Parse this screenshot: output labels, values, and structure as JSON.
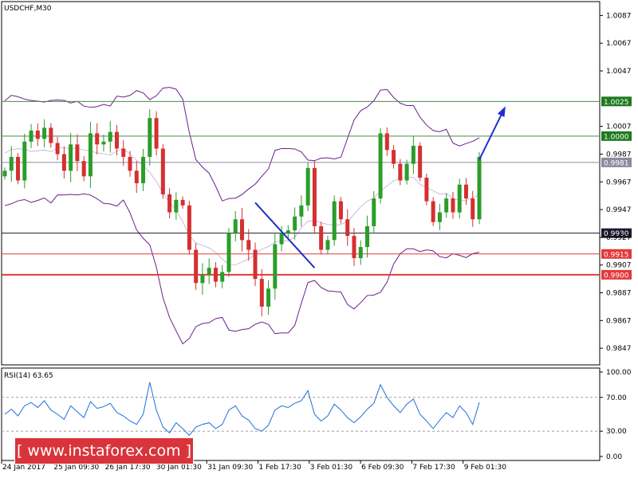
{
  "chart_data": [
    {
      "type": "candlestick",
      "title": "USDCHF,M30",
      "ylim": [
        0.9835,
        1.0097
      ],
      "y_ticks": [
        "1.0087",
        "1.0067",
        "1.0047",
        "1.0007",
        "0.9987",
        "0.9967",
        "0.9947",
        "0.9927",
        "0.9907",
        "0.9887",
        "0.9867",
        "0.9847"
      ],
      "x_ticks": [
        "24 Jan 2017",
        "25 Jan 09:30",
        "26 Jan 17:30",
        "30 Jan 01:30",
        "31 Jan 09:30",
        "1 Feb 17:30",
        "3 Feb 01:30",
        "6 Feb 09:30",
        "7 Feb 17:30",
        "9 Feb 01:30"
      ],
      "price_series": {
        "name": "",
        "points": [
          0.9975,
          0.9985,
          0.9968,
          0.9996,
          1.0004,
          0.9998,
          1.0006,
          0.9995,
          0.9987,
          0.9975,
          0.9994,
          0.9982,
          0.9971,
          1.0002,
          0.9994,
          0.9996,
          1.0003,
          0.9991,
          0.9985,
          0.9975,
          0.9966,
          0.9985,
          1.0013,
          0.9991,
          0.9958,
          0.9945,
          0.9954,
          0.995,
          0.9918,
          0.9894,
          0.99,
          0.9905,
          0.9895,
          0.9902,
          0.993,
          0.994,
          0.9925,
          0.9918,
          0.9897,
          0.9877,
          0.989,
          0.9922,
          0.993,
          0.9932,
          0.9942,
          0.995,
          0.9977,
          0.9935,
          0.9918,
          0.9925,
          0.9953,
          0.994,
          0.9928,
          0.9912,
          0.992,
          0.9935,
          0.9955,
          1.0002,
          0.999,
          0.998,
          0.9968,
          0.998,
          0.9993,
          0.997,
          0.9953,
          0.9938,
          0.9945,
          0.9955,
          0.9945,
          0.9965,
          0.9955,
          0.994,
          0.9985
        ]
      },
      "horizontal_levels": [
        {
          "label": "1.0025",
          "value": 1.0025,
          "color": "#1f7a1f",
          "line_color": "#4a8a4a",
          "width": 1
        },
        {
          "label": "1.0000",
          "value": 1.0,
          "color": "#1f7a1f",
          "line_color": "#4a8a4a",
          "width": 1
        },
        {
          "label": "0.9981",
          "value": 0.9981,
          "color": "#8c8ca0",
          "line_color": "#8c8ca0",
          "width": 1
        },
        {
          "label": "0.9930",
          "value": 0.993,
          "color": "#1a1a2e",
          "line_color": "#1a1a2e",
          "width": 1
        },
        {
          "label": "0.9915",
          "value": 0.9915,
          "color": "#e33a3a",
          "line_color": "#e33a3a",
          "width": 1
        },
        {
          "label": "0.9900",
          "value": 0.99,
          "color": "#e33a3a",
          "line_color": "#e33a3a",
          "width": 2
        }
      ],
      "annotations": {
        "downtrend_line": {
          "from_bar": 38,
          "to_bar": 47,
          "from_price": 0.9952,
          "to_price": 0.9905,
          "color": "#1f2fbf"
        },
        "target_arrow": {
          "from_bar": 72,
          "to_bar": 74,
          "from_price": 0.9983,
          "to_price": 1.002,
          "color": "#1f2fd0"
        }
      },
      "colors": {
        "bull": "#2a9d2a",
        "bear": "#d43030",
        "bands": "#6b1f8a"
      }
    },
    {
      "type": "line",
      "title": "RSI(14) 63.65",
      "ylim": [
        0,
        100
      ],
      "y_ticks": [
        "100.00",
        "70.00",
        "30.00",
        "0.00"
      ],
      "levels": [
        70,
        30
      ],
      "series": [
        {
          "name": "",
          "values": [
            50,
            56,
            48,
            60,
            64,
            58,
            66,
            55,
            50,
            44,
            60,
            53,
            46,
            65,
            57,
            59,
            63,
            52,
            48,
            42,
            38,
            50,
            88,
            55,
            35,
            28,
            40,
            33,
            25,
            35,
            38,
            40,
            33,
            38,
            55,
            60,
            48,
            43,
            33,
            30,
            37,
            55,
            60,
            58,
            63,
            66,
            78,
            50,
            42,
            48,
            62,
            55,
            46,
            40,
            47,
            56,
            63,
            85,
            70,
            60,
            52,
            62,
            68,
            50,
            42,
            33,
            43,
            52,
            46,
            60,
            52,
            38,
            64
          ]
        }
      ],
      "color": "#1e6fd9"
    }
  ],
  "watermark": {
    "text": "[ www.instaforex.com ]"
  }
}
